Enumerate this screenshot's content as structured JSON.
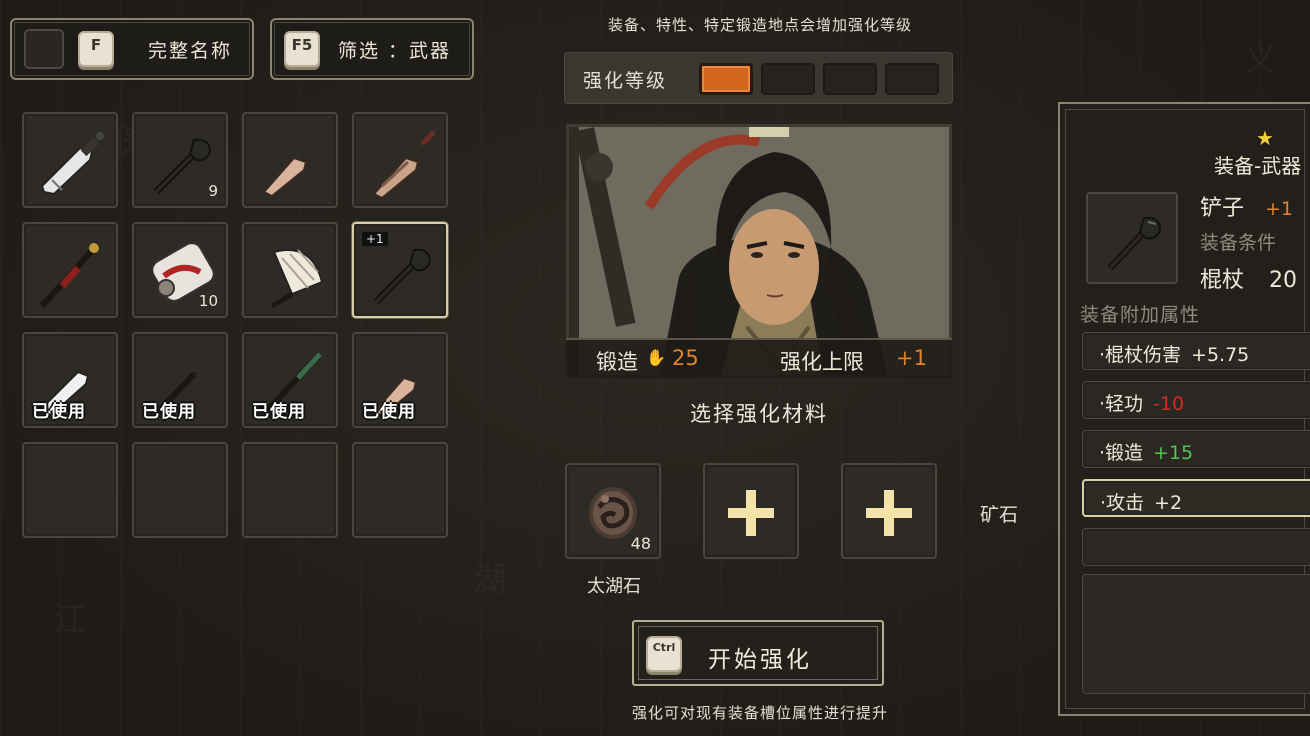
{
  "header": {
    "fullname_key": "F",
    "fullname_label": "完整名称",
    "filter_key": "F5",
    "filter_label": "筛选 ：武器"
  },
  "inventory": {
    "slots": [
      {
        "item": "broadsword",
        "qty": "",
        "used": "",
        "badge": ""
      },
      {
        "item": "spade",
        "qty": "9",
        "used": "",
        "badge": ""
      },
      {
        "item": "dagger",
        "qty": "",
        "used": "",
        "badge": ""
      },
      {
        "item": "dagger-brown",
        "qty": "",
        "used": "",
        "badge": ""
      },
      {
        "item": "red-spear",
        "qty": "",
        "used": "",
        "badge": ""
      },
      {
        "item": "bandage-scroll",
        "qty": "10",
        "used": "",
        "badge": ""
      },
      {
        "item": "feather-fan",
        "qty": "",
        "used": "",
        "badge": ""
      },
      {
        "item": "spade",
        "qty": "",
        "used": "",
        "badge": "+1"
      },
      {
        "item": "sword",
        "qty": "",
        "used": "已使用",
        "badge": ""
      },
      {
        "item": "trident",
        "qty": "",
        "used": "已使用",
        "badge": ""
      },
      {
        "item": "green-spear",
        "qty": "",
        "used": "已使用",
        "badge": ""
      },
      {
        "item": "dagger",
        "qty": "",
        "used": "已使用",
        "badge": ""
      },
      {
        "item": "",
        "qty": "",
        "used": "",
        "badge": ""
      },
      {
        "item": "",
        "qty": "",
        "used": "",
        "badge": ""
      },
      {
        "item": "",
        "qty": "",
        "used": "",
        "badge": ""
      },
      {
        "item": "",
        "qty": "",
        "used": "",
        "badge": ""
      }
    ]
  },
  "forge": {
    "top_note": "装备、特性、特定锻造地点会增加强化等级",
    "level_label": "强化等级",
    "level_current": 1,
    "level_max": 4,
    "forging_label": "锻造",
    "forging_value": "25",
    "cap_label": "强化上限",
    "cap_value": "+1",
    "choose_title": "选择强化材料",
    "material_name": "太湖石",
    "material_qty": "48",
    "ore_label": "矿石",
    "start_key": "Ctrl",
    "start_label": "开始强化",
    "foot_note": "强化可对现有装备槽位属性进行提升"
  },
  "detail": {
    "type_label": "装备-武器",
    "item_name": "铲子",
    "item_plus": "+1",
    "req_label": "装备条件",
    "req_skill": "棍杖",
    "req_value": "20",
    "attr_title": "装备附加属性",
    "attrs": [
      {
        "label": "·棍杖伤害",
        "value": "+5.75",
        "color": "#efe8d8"
      },
      {
        "label": "·轻功",
        "value": "-10",
        "color": "#d12a22"
      },
      {
        "label": "·锻造",
        "value": "+15",
        "color": "#55c255"
      },
      {
        "label": "·攻击",
        "value": "+2",
        "color": "#efe8d8"
      }
    ]
  },
  "colors": {
    "accent_orange": "#e0822c",
    "positive": "#55c255",
    "negative": "#d12a22",
    "star": "#f4cf38"
  }
}
